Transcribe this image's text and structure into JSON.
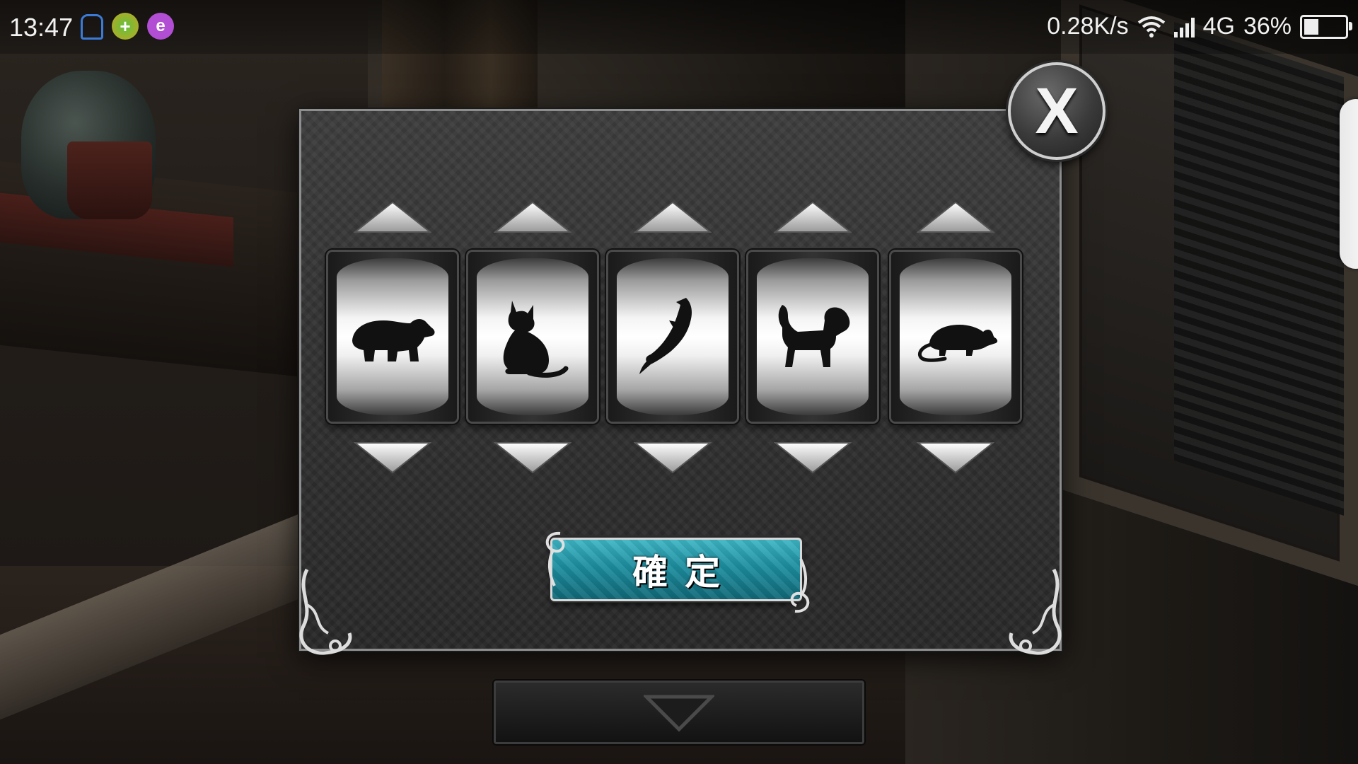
{
  "status_bar": {
    "time": "13:47",
    "network_speed": "0.28K/s",
    "network_type": "4G",
    "battery": "36%",
    "battery_level": 0.36,
    "app_icons": [
      "notification-bell-icon",
      "plus-circle-icon",
      "browser-e-icon"
    ]
  },
  "dialog": {
    "close_label": "X",
    "confirm_label": "確定",
    "reels": [
      {
        "symbol": "bear"
      },
      {
        "symbol": "cat"
      },
      {
        "symbol": "fish"
      },
      {
        "symbol": "dog"
      },
      {
        "symbol": "rat"
      }
    ]
  },
  "colors": {
    "confirm_button": "#1d8e9f",
    "dialog_background": "#2e2e2e",
    "dialog_border": "#8e8e8e"
  }
}
